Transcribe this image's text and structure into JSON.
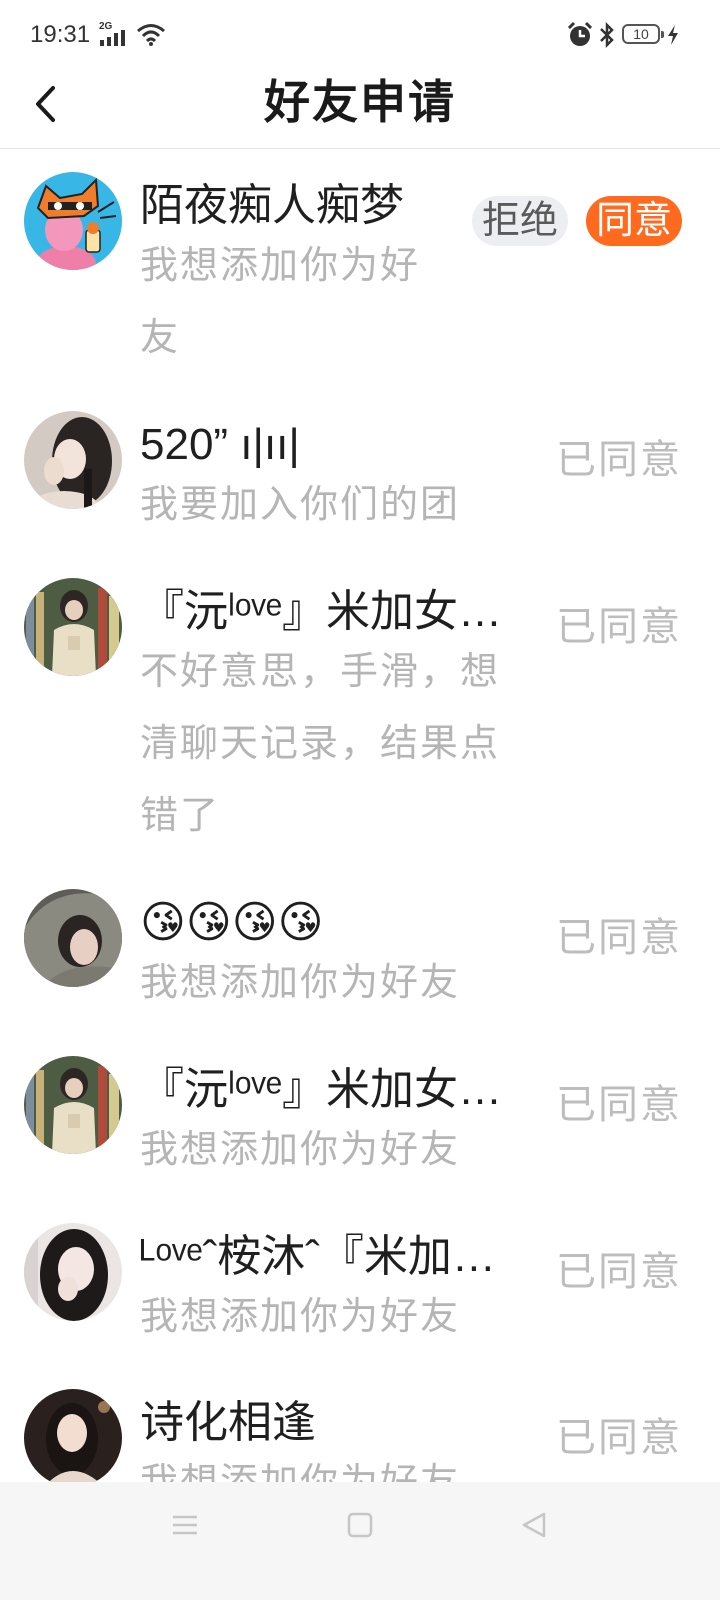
{
  "status_bar": {
    "time": "19:31",
    "network": "2G",
    "battery": "10",
    "icons": [
      "signal-icon",
      "wifi-icon",
      "alarm-icon",
      "bluetooth-icon",
      "battery-icon",
      "charging-icon"
    ]
  },
  "header": {
    "title": "好友申请",
    "back_icon": "chevron-left-icon"
  },
  "requests": [
    {
      "name": "陌夜痴人痴梦",
      "message": "我想添加你为好友",
      "reject_label": "拒绝",
      "accept_label": "同意"
    },
    {
      "name": "520”   ı|ıı|",
      "message": "我要加入你们的团",
      "status": "已同意"
    },
    {
      "name": "『沅ˡᵒᵛᵉ』米加女…",
      "message": "不好意思，手滑，想清聊天记录，结果点错了",
      "status": "已同意"
    },
    {
      "name": "😘😘😘😘",
      "message": "我想添加你为好友",
      "status": "已同意"
    },
    {
      "name": "『沅ˡᵒᵛᵉ』米加女…",
      "message": "我想添加你为好友",
      "status": "已同意"
    },
    {
      "name": "ᴸᵒᵛᵉˆ桉沐ˆ『米加…",
      "message": "我想添加你为好友",
      "status": "已同意"
    },
    {
      "name": "诗化相逢",
      "message": "我想添加你为好友",
      "status": "已同意"
    }
  ],
  "nav_bar": {
    "icons": [
      "menu-icon",
      "home-icon",
      "back-triangle-icon"
    ]
  },
  "colors": {
    "accent": "#ff6a1f",
    "reject_bg": "#eceef2",
    "secondary_text": "#b5b5b5",
    "status_text": "#bdbdbd"
  }
}
